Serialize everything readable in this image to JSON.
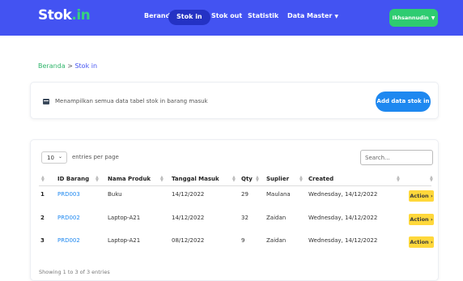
{
  "navbar": {
    "brand_main": "Stok",
    "brand_accent": ".in",
    "items": [
      {
        "label": "Beranda"
      },
      {
        "label": "Stok in"
      },
      {
        "label": "Stok out"
      },
      {
        "label": "Statistik"
      },
      {
        "label": "Data Master"
      }
    ],
    "user_label": "Ikhsannudin",
    "color_bg": "#4353f2",
    "color_active": "#2432c4",
    "color_user": "#2ecc71"
  },
  "breadcrumb": {
    "home": "Beranda",
    "separator": " > ",
    "current": "Stok in"
  },
  "info": {
    "text": "Menampilkan semua data tabel stok in barang masuk",
    "add_button": "Add data stok in",
    "icon": "table-icon"
  },
  "table": {
    "length_value": "10",
    "length_label": "entries per page",
    "search_placeholder": "Search...",
    "columns": [
      "ID Barang",
      "Nama Produk",
      "Tanggal Masuk",
      "Qty",
      "Suplier",
      "Created"
    ],
    "rows": [
      {
        "num": "1",
        "id": "PRD003",
        "nama": "Buku",
        "tanggal": "14/12/2022",
        "qty": "29",
        "suplier": "Maulana",
        "created": "Wednesday, 14/12/2022",
        "action": "Action"
      },
      {
        "num": "2",
        "id": "PRD002",
        "nama": "Laptop-A21",
        "tanggal": "14/12/2022",
        "qty": "32",
        "suplier": "Zaidan",
        "created": "Wednesday, 14/12/2022",
        "action": "Action"
      },
      {
        "num": "3",
        "id": "PRD002",
        "nama": "Laptop-A21",
        "tanggal": "08/12/2022",
        "qty": "9",
        "suplier": "Zaidan",
        "created": "Wednesday, 14/12/2022",
        "action": "Action"
      }
    ],
    "footer": "Showing 1 to 3 of 3 entries",
    "color_link": "#1e88f0",
    "color_action": "#ffd83b"
  }
}
